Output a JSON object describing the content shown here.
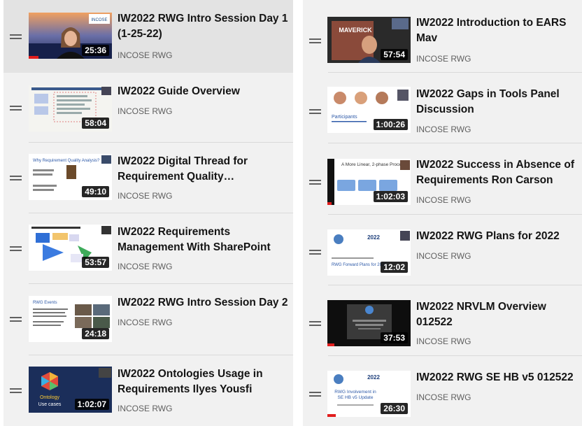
{
  "playlist": {
    "left": [
      {
        "title_lines": [
          "IW2022 RWG Intro Session Day 1",
          "(1-25-22)"
        ],
        "channel": "INCOSE RWG",
        "duration": "25:36",
        "watched": 0.12,
        "selected": true
      },
      {
        "title_lines": [
          "IW2022 Guide Overview"
        ],
        "channel": "INCOSE RWG",
        "duration": "58:04",
        "watched": 0,
        "selected": false
      },
      {
        "title_lines": [
          "IW2022 Digital Thread for",
          "Requirement Quality…"
        ],
        "channel": "INCOSE RWG",
        "duration": "49:10",
        "watched": 0,
        "selected": false
      },
      {
        "title_lines": [
          "IW2022 Requirements",
          "Management With SharePoint"
        ],
        "channel": "INCOSE RWG",
        "duration": "53:57",
        "watched": 0,
        "selected": false
      },
      {
        "title_lines": [
          "IW2022 RWG Intro Session Day 2"
        ],
        "channel": "INCOSE RWG",
        "duration": "24:18",
        "watched": 0,
        "selected": false
      },
      {
        "title_lines": [
          "IW2022 Ontologies Usage in",
          "Requirements Ilyes Yousfi"
        ],
        "channel": "INCOSE RWG",
        "duration": "1:02:07",
        "watched": 0,
        "selected": false
      }
    ],
    "right": [
      {
        "title_lines": [
          "IW2022 Introduction to EARS",
          "Mav"
        ],
        "channel": "INCOSE RWG",
        "duration": "57:54",
        "watched": 0,
        "selected": false
      },
      {
        "title_lines": [
          "IW2022 Gaps in Tools Panel",
          "Discussion"
        ],
        "channel": "INCOSE RWG",
        "duration": "1:00:26",
        "watched": 0,
        "selected": false
      },
      {
        "title_lines": [
          "IW2022 Success in Absence of",
          "Requirements Ron Carson"
        ],
        "channel": "INCOSE RWG",
        "duration": "1:02:03",
        "watched": 0.05,
        "selected": false
      },
      {
        "title_lines": [
          "IW2022 RWG Plans for 2022"
        ],
        "channel": "INCOSE RWG",
        "duration": "12:02",
        "watched": 0,
        "selected": false
      },
      {
        "title_lines": [
          "IW2022 NRVLM Overview",
          "012522"
        ],
        "channel": "INCOSE RWG",
        "duration": "37:53",
        "watched": 0.08,
        "selected": false
      },
      {
        "title_lines": [
          "IW2022 RWG SE HB v5 012522"
        ],
        "channel": "INCOSE RWG",
        "duration": "26:30",
        "watched": 0.1,
        "selected": false
      }
    ]
  },
  "thumb_text": {
    "intro1": "INCOSE",
    "digital": "Why Requirement Quality Analysis?",
    "rwgevents": "RWG Events",
    "ontology_a": "Ontology",
    "ontology_b": "Use cases",
    "ears": "MAVERICK",
    "gaps": "Participants",
    "success": "A More Linear, 2-phase Process",
    "plans_year": "2022",
    "plans_caption": "RWG Forward Plans for 2022",
    "hb_year": "2022",
    "hb_caption_1": "RWG Involvement in",
    "hb_caption_2": "SE HB v5 Update"
  },
  "colors": {
    "progress": "#e11d1d",
    "selected_row": "#e3e3e3",
    "title": "#141414",
    "channel": "#606060"
  }
}
